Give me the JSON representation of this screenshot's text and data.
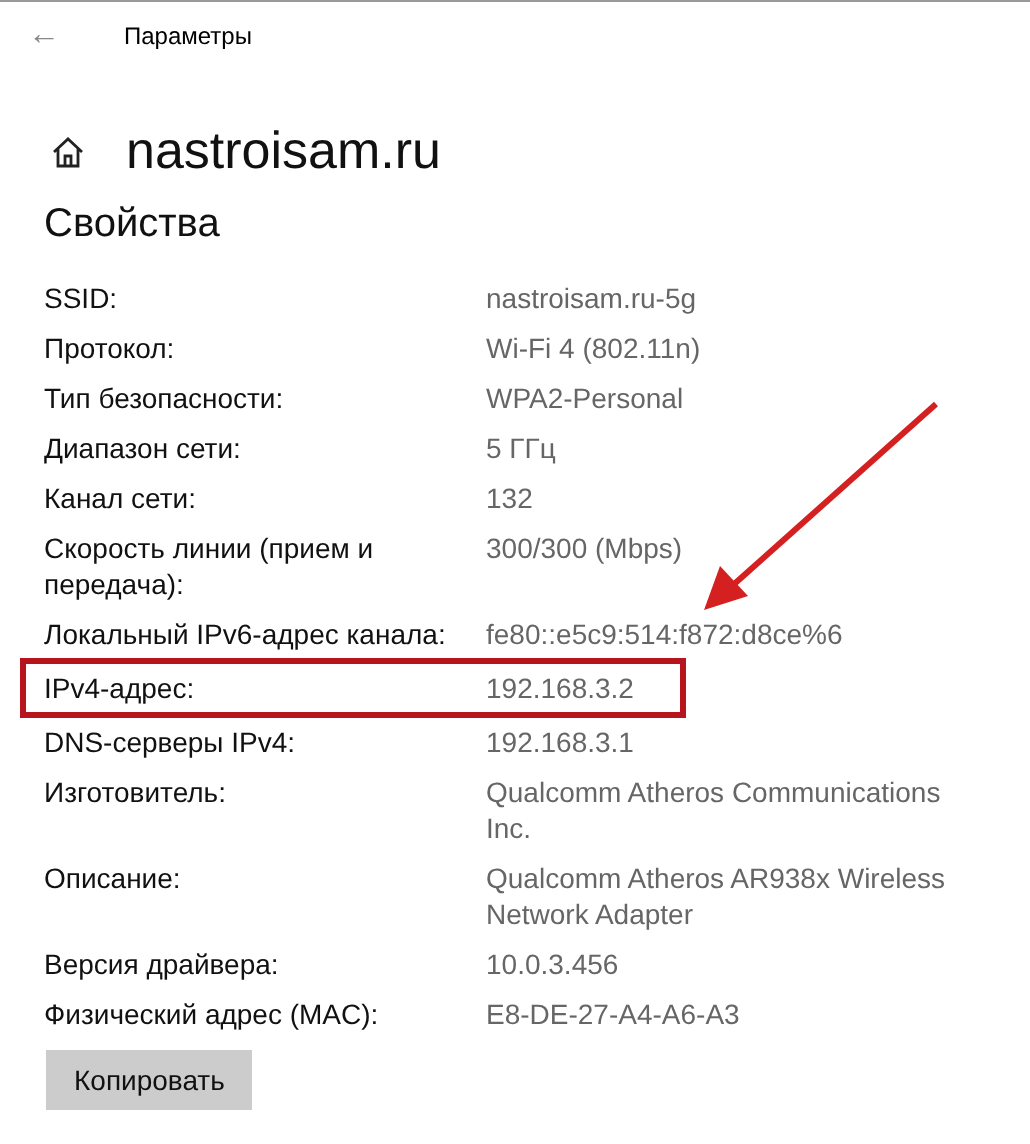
{
  "window": {
    "title": "Параметры",
    "back": "←"
  },
  "network_name": "nastroisam.ru",
  "section_title": "Свойства",
  "properties": [
    {
      "label": "SSID:",
      "value": "nastroisam.ru-5g",
      "highlighted": false
    },
    {
      "label": "Протокол:",
      "value": "Wi-Fi 4 (802.11n)",
      "highlighted": false
    },
    {
      "label": "Тип безопасности:",
      "value": "WPA2-Personal",
      "highlighted": false
    },
    {
      "label": "Диапазон сети:",
      "value": "5 ГГц",
      "highlighted": false
    },
    {
      "label": "Канал сети:",
      "value": "132",
      "highlighted": false
    },
    {
      "label": "Скорость линии (прием и передача):",
      "value": "300/300 (Mbps)",
      "highlighted": false
    },
    {
      "label": "Локальный IPv6-адрес канала:",
      "value": "fe80::e5c9:514:f872:d8ce%6",
      "highlighted": false
    },
    {
      "label": "IPv4-адрес:",
      "value": "192.168.3.2",
      "highlighted": true
    },
    {
      "label": "DNS-серверы IPv4:",
      "value": "192.168.3.1",
      "highlighted": false
    },
    {
      "label": "Изготовитель:",
      "value": "Qualcomm Atheros Communications Inc.",
      "highlighted": false
    },
    {
      "label": "Описание:",
      "value": "Qualcomm Atheros AR938x Wireless Network Adapter",
      "highlighted": false
    },
    {
      "label": "Версия драйвера:",
      "value": "10.0.3.456",
      "highlighted": false
    },
    {
      "label": "Физический адрес (MAC):",
      "value": "E8-DE-27-A4-A6-A3",
      "highlighted": false
    }
  ],
  "copy_button": "Копировать"
}
